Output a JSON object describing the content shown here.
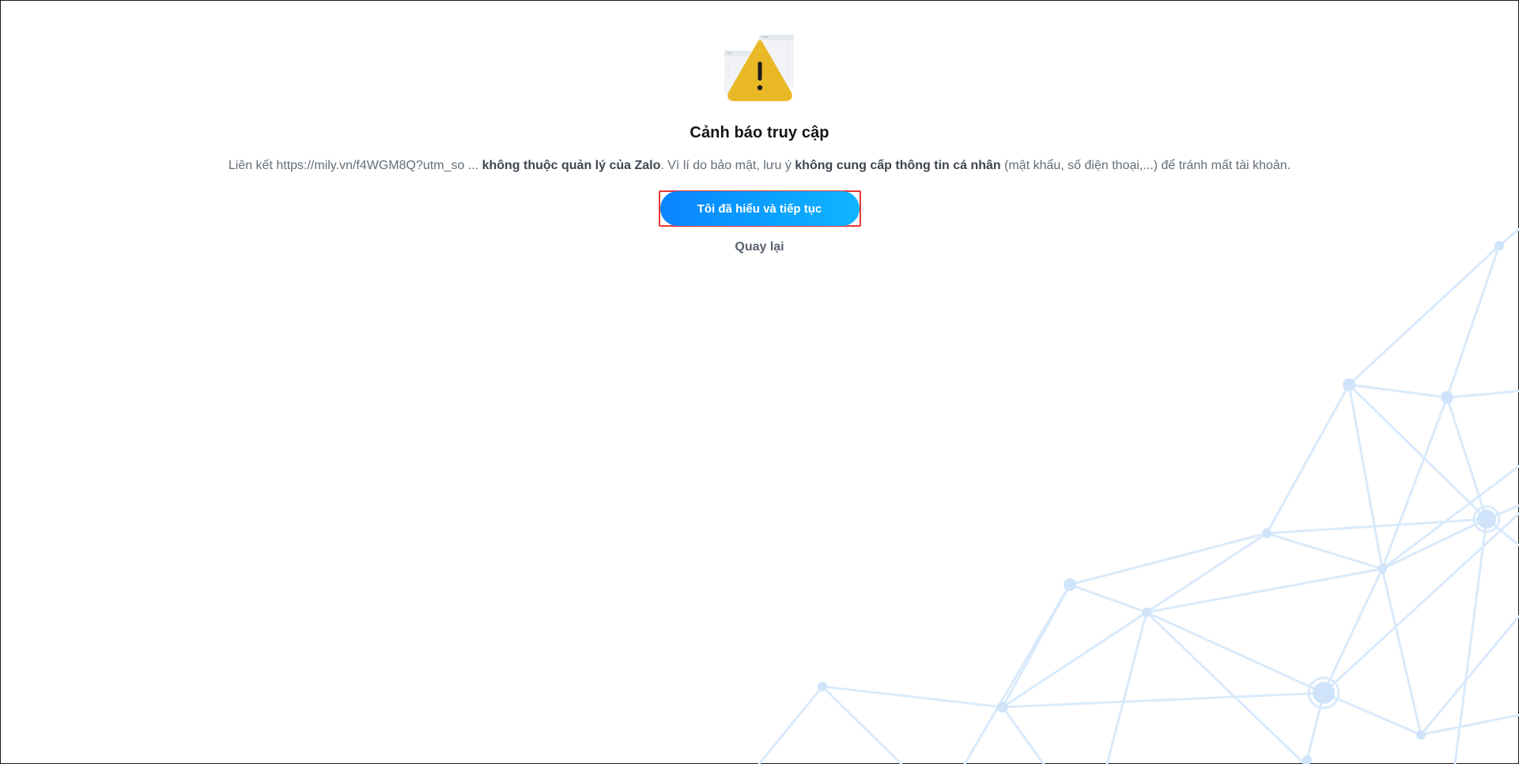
{
  "warning": {
    "icon": "warning-triangle-icon",
    "title": "Cảnh báo truy cập",
    "message": {
      "prefix": "Liên kết https://mily.vn/f4WGM8Q?utm_so ... ",
      "bold1": "không thuộc quản lý của Zalo",
      "middle": ". Vì lí do bảo mật, lưu ý ",
      "bold2": "không cung cấp thông tin cá nhân",
      "suffix": " (mật khẩu, số điện thoại,...) để tránh mất tài khoản."
    },
    "continue_label": "Tôi đã hiểu và tiếp tục",
    "back_label": "Quay lại"
  },
  "colors": {
    "accent": "#0a8dff",
    "warning_yellow": "#e9b825",
    "highlight_border": "#e53935",
    "network_line": "#d6e8fb"
  }
}
